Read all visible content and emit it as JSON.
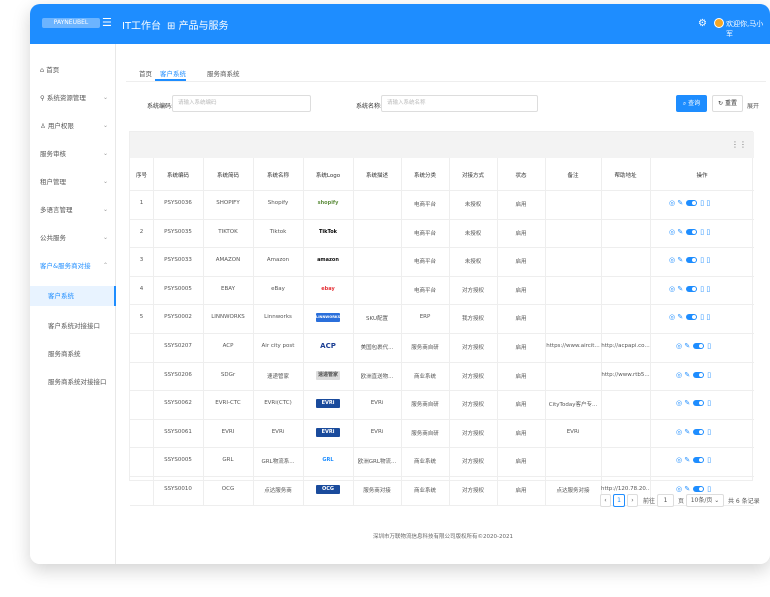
{
  "topbar": {
    "logo_text": "PAYNEUBEL",
    "nav_it": "IT工作台",
    "nav_products": "产品与服务",
    "welcome": "欢迎你,马小军"
  },
  "sidebar": {
    "items": [
      {
        "label": "首页",
        "icon": "home-icon"
      },
      {
        "label": "系统资源管理",
        "icon": "lock-icon"
      },
      {
        "label": "用户权限",
        "icon": "user-icon"
      },
      {
        "label": "服务审核"
      },
      {
        "label": "租户管理"
      },
      {
        "label": "多语言管理"
      },
      {
        "label": "公共服务"
      },
      {
        "label": "客户&服务商对接"
      },
      {
        "label": "客户系统"
      },
      {
        "label": "客户系统对接接口"
      },
      {
        "label": "服务商系统"
      },
      {
        "label": "服务商系统对接接口"
      }
    ]
  },
  "tabs": [
    "首页",
    "客户系统",
    "服务商系统"
  ],
  "search": {
    "code_label": "系统编码:",
    "code_placeholder": "请输入系统编码",
    "name_label": "系统名称:",
    "name_placeholder": "请输入系统名称",
    "query_label": "查询",
    "reset_label": "重置",
    "expand_label": "展开"
  },
  "table": {
    "headers": [
      "序号",
      "系统编码",
      "系统简码",
      "系统名称",
      "系统Logo",
      "系统描述",
      "系统分类",
      "对接方式",
      "状态",
      "备注",
      "帮助地址",
      "操作"
    ],
    "rows": [
      {
        "no": "1",
        "code": "PSYS0036",
        "short": "SHOPIFY",
        "name": "Shopify",
        "logo": "shopify",
        "desc": "",
        "cat": "电商平台",
        "mode": "未授权",
        "status": "启用",
        "note": "",
        "help": ""
      },
      {
        "no": "2",
        "code": "PSYS0035",
        "short": "TIKTOK",
        "name": "Tiktok",
        "logo": "TikTok",
        "desc": "",
        "cat": "电商平台",
        "mode": "未授权",
        "status": "启用",
        "note": "",
        "help": ""
      },
      {
        "no": "3",
        "code": "PSYS0033",
        "short": "AMAZON",
        "name": "Amazon",
        "logo": "amazon",
        "desc": "",
        "cat": "电商平台",
        "mode": "未授权",
        "status": "启用",
        "note": "",
        "help": ""
      },
      {
        "no": "4",
        "code": "PSYS0005",
        "short": "EBAY",
        "name": "eBay",
        "logo": "ebay",
        "desc": "",
        "cat": "电商平台",
        "mode": "对方授权",
        "status": "启用",
        "note": "",
        "help": ""
      },
      {
        "no": "5",
        "code": "PSYS0002",
        "short": "LINNWORKS",
        "name": "Linnworks",
        "logo": "LINNWORKS",
        "desc": "SKU配置",
        "cat": "ERP",
        "mode": "我方授权",
        "status": "启用",
        "note": "",
        "help": ""
      },
      {
        "no": "",
        "code": "SSYS0207",
        "short": "ACP",
        "name": "Air city post",
        "logo": "ACP",
        "desc": "美国包裹代...",
        "cat": "服务商自研",
        "mode": "对方授权",
        "status": "启用",
        "note": "https://www.aircit...",
        "help": "http://acpapi.co..."
      },
      {
        "no": "",
        "code": "SSYS0206",
        "short": "SDGr",
        "name": "速递管家",
        "logo": "速递管家",
        "desc": "欧洲直送物...",
        "cat": "商业系统",
        "mode": "对方授权",
        "status": "启用",
        "note": "",
        "help": "http://www.rtb5..."
      },
      {
        "no": "",
        "code": "SSYS0062",
        "short": "EVRI-CTC",
        "name": "EVRi(CTC)",
        "logo": "EVRi",
        "desc": "EVRi",
        "cat": "服务商自研",
        "mode": "对方授权",
        "status": "启用",
        "note": "CityToday客户专...",
        "help": ""
      },
      {
        "no": "",
        "code": "SSYS0061",
        "short": "EVRI",
        "name": "EVRi",
        "logo": "EVRi",
        "desc": "EVRi",
        "cat": "服务商自研",
        "mode": "对方授权",
        "status": "启用",
        "note": "EVRi",
        "help": ""
      },
      {
        "no": "",
        "code": "SSYS0005",
        "short": "GRL",
        "name": "GRL物流系...",
        "logo": "GRL",
        "desc": "欧洲GRL物流...",
        "cat": "商业系统",
        "mode": "对方授权",
        "status": "启用",
        "note": "",
        "help": ""
      },
      {
        "no": "",
        "code": "SSYS0010",
        "short": "OCG",
        "name": "点达服务商",
        "logo": "OCG",
        "desc": "服务商对接",
        "cat": "商业系统",
        "mode": "对方授权",
        "status": "启用",
        "note": "点达服务对接",
        "help": "http://120.78.20..."
      }
    ]
  },
  "pager": {
    "page": "1",
    "goto_label": "前往",
    "goto_value": "1",
    "page_unit": "页",
    "size_label": "10条/页",
    "total_label": "共 6 条记录"
  },
  "footer": "深圳市万联物流信息科技有限公司版权所有©2020-2021",
  "colors": {
    "primary": "#1e8dff"
  }
}
